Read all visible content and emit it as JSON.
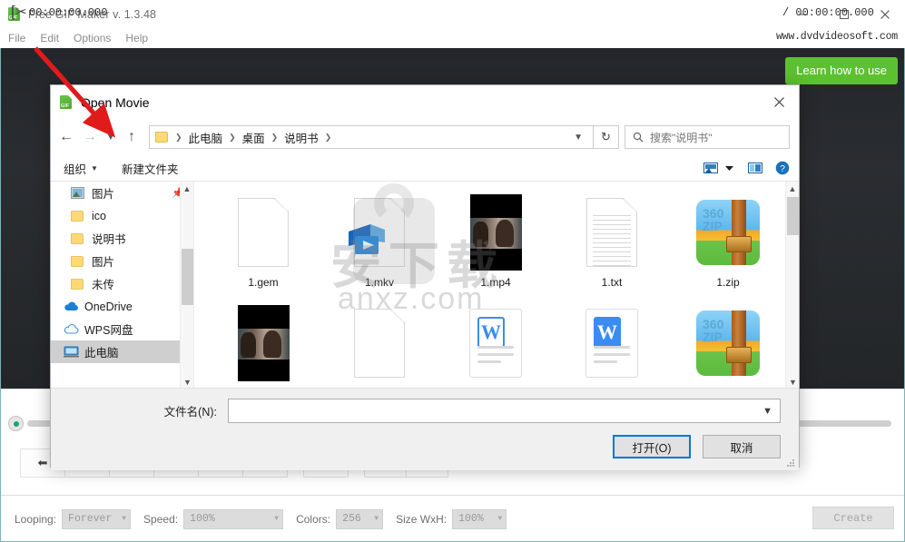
{
  "app": {
    "title": "Free GIF Maker v. 1.3.48",
    "icon": "gif-app-icon",
    "menus": [
      "File",
      "Edit",
      "Options",
      "Help"
    ],
    "brand_url": "www.dvdvideosoft.com",
    "learn_button": "Learn how to use",
    "window_controls": {
      "minimize": "minimize-icon",
      "maximize": "maximize-icon",
      "close": "close-icon"
    }
  },
  "timeline": {
    "cut_icon": "scissors-icon",
    "time_current": "00:00:00.000",
    "time_separator": "/",
    "time_total": "00:00:00.000"
  },
  "settings": {
    "looping_label": "Looping:",
    "looping_value": "Forever",
    "speed_label": "Speed:",
    "speed_value": "100%",
    "colors_label": "Colors:",
    "colors_value": "256",
    "size_label": "Size WxH:",
    "size_value": "100%",
    "create_button": "Create"
  },
  "dialog": {
    "title": "Open Movie",
    "icon": "gif-app-icon",
    "close_icon": "close-icon",
    "nav": {
      "back_icon": "arrow-left-icon",
      "forward_icon": "arrow-right-icon",
      "recent_icon": "chevron-down-icon",
      "up_icon": "arrow-up-icon",
      "refresh_icon": "refresh-icon",
      "breadcrumbs": [
        "此电脑",
        "桌面",
        "说明书"
      ],
      "breadcrumb_caret": "chevron-down-icon",
      "search_icon": "search-icon",
      "search_placeholder": "搜索\"说明书\""
    },
    "toolbar": {
      "organize": "组织",
      "new_folder": "新建文件夹",
      "view_icon": "view-layout-icon",
      "view_caret": "chevron-down-icon",
      "pane_icon": "preview-pane-icon",
      "help_icon": "help-icon"
    },
    "sidebar": [
      {
        "label": "图片",
        "icon": "picture-icon",
        "pinned": true,
        "selected": false
      },
      {
        "label": "ico",
        "icon": "folder-icon",
        "pinned": false,
        "selected": false
      },
      {
        "label": "说明书",
        "icon": "folder-icon",
        "pinned": false,
        "selected": false
      },
      {
        "label": "图片",
        "icon": "folder-icon",
        "pinned": false,
        "selected": false
      },
      {
        "label": "未传",
        "icon": "folder-icon",
        "pinned": false,
        "selected": false
      },
      {
        "label": "OneDrive",
        "icon": "cloud-icon",
        "pinned": false,
        "selected": false
      },
      {
        "label": "WPS网盘",
        "icon": "cloud-outline-icon",
        "pinned": false,
        "selected": false
      },
      {
        "label": "此电脑",
        "icon": "computer-icon",
        "pinned": false,
        "selected": true
      }
    ],
    "files": [
      {
        "name": "1.gem",
        "type": "blank-document"
      },
      {
        "name": "1.mkv",
        "type": "video-document"
      },
      {
        "name": "1.mp4",
        "type": "video-thumbnail"
      },
      {
        "name": "1.txt",
        "type": "text-document"
      },
      {
        "name": "1.zip",
        "type": "zip-archive"
      },
      {
        "name": "",
        "type": "video-thumbnail"
      },
      {
        "name": "",
        "type": "blank-document"
      },
      {
        "name": "",
        "type": "wps-document-outline"
      },
      {
        "name": "",
        "type": "wps-document-solid"
      },
      {
        "name": "",
        "type": "zip-archive"
      }
    ],
    "watermark": {
      "cn": "安下载",
      "en": "anxz.com"
    },
    "footer": {
      "filename_label": "文件名(N):",
      "filename_value": "",
      "filename_caret": "chevron-down-icon",
      "open_button": "打开(O)",
      "cancel_button": "取消"
    }
  },
  "annotation": {
    "arrow": "red-arrow-pointer",
    "color": "#e01b1b"
  }
}
